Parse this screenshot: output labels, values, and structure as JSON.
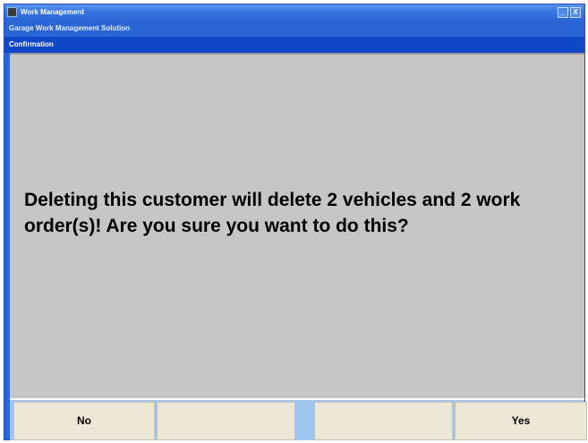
{
  "window": {
    "title": "Work Management",
    "minimize_label": "_",
    "close_label": "X"
  },
  "subtitle": "Garage Work Management Solution",
  "dialog": {
    "title": "Confirmation",
    "message": "Deleting this customer will delete 2 vehicles and 2 work order(s)! Are you sure you want to do this?"
  },
  "buttons": {
    "no_label": "No",
    "blank2_label": "",
    "blank3_label": "",
    "yes_label": "Yes"
  },
  "colors": {
    "titlebar": "#2a66d6",
    "dialog_header": "#1046c8",
    "dialog_body": "#c8c5c9",
    "button_face": "#ece7d7",
    "button_bar": "#9ec4ef"
  }
}
